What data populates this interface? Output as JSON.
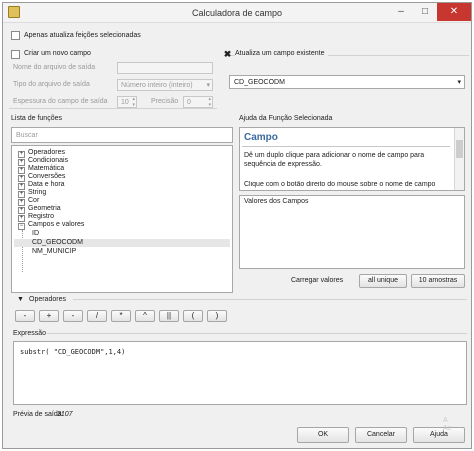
{
  "window": {
    "title": "Calculadora de campo",
    "controls": {
      "minimize": "–",
      "maximize": "□",
      "close": "✕"
    }
  },
  "top": {
    "only_selected_label": "Apenas atualiza feições selecionadas",
    "only_selected_checked": false
  },
  "new_field": {
    "checked": false,
    "label": "Criar um novo campo",
    "name_label": "Nome do arquivo de saída",
    "name_value": "",
    "type_label": "Tipo do arquivo de saída",
    "type_value": "Número inteiro (inteiro)",
    "width_label": "Espessura do campo de saída",
    "width_value": "10",
    "precision_label": "Precisão",
    "precision_value": "0"
  },
  "update_field": {
    "checked": true,
    "label": "Atualiza um campo existente",
    "selected": "CD_GEOCODM"
  },
  "functions": {
    "label": "Lista de funções",
    "search_placeholder": "Buscar",
    "tree": [
      {
        "label": "Operadores",
        "expandable": true
      },
      {
        "label": "Condicionais",
        "expandable": true
      },
      {
        "label": "Matemática",
        "expandable": true
      },
      {
        "label": "Conversões",
        "expandable": true
      },
      {
        "label": "Data e hora",
        "expandable": true
      },
      {
        "label": "String",
        "expandable": true
      },
      {
        "label": "Cor",
        "expandable": true
      },
      {
        "label": "Geometria",
        "expandable": true
      },
      {
        "label": "Registro",
        "expandable": true
      },
      {
        "label": "Campos e valores",
        "expandable": true,
        "expanded": true
      }
    ],
    "fields": [
      "ID",
      "CD_GEOCODM",
      "NM_MUNICIP"
    ],
    "selected_field": "CD_GEOCODM"
  },
  "help": {
    "label": "Ajuda da Função Selecionada",
    "title": "Campo",
    "text1": "Dê um duplo clique para adicionar o nome de campo para sequência de expressão.",
    "text2": "Clique com o botão direito do mouse sobre o nome de campo"
  },
  "values": {
    "label": "Valores dos Campos",
    "load_label": "Carregar valores",
    "unique_button": "all unique",
    "samples_button": "10 amostras"
  },
  "operators": {
    "label": "Operadores",
    "buttons": [
      "-",
      "+",
      "-",
      "/",
      "*",
      "^",
      "||",
      "(",
      ")"
    ]
  },
  "expression": {
    "label": "Expressão",
    "value": "substr( \"CD_GEOCODM\",1,4)"
  },
  "preview": {
    "label": "Prévia de saída:",
    "value": "3107"
  },
  "buttons": {
    "ok": "OK",
    "cancel": "Cancelar",
    "help": "Ajuda"
  },
  "watermark": {
    "line1": "A",
    "line2": "Ac"
  }
}
